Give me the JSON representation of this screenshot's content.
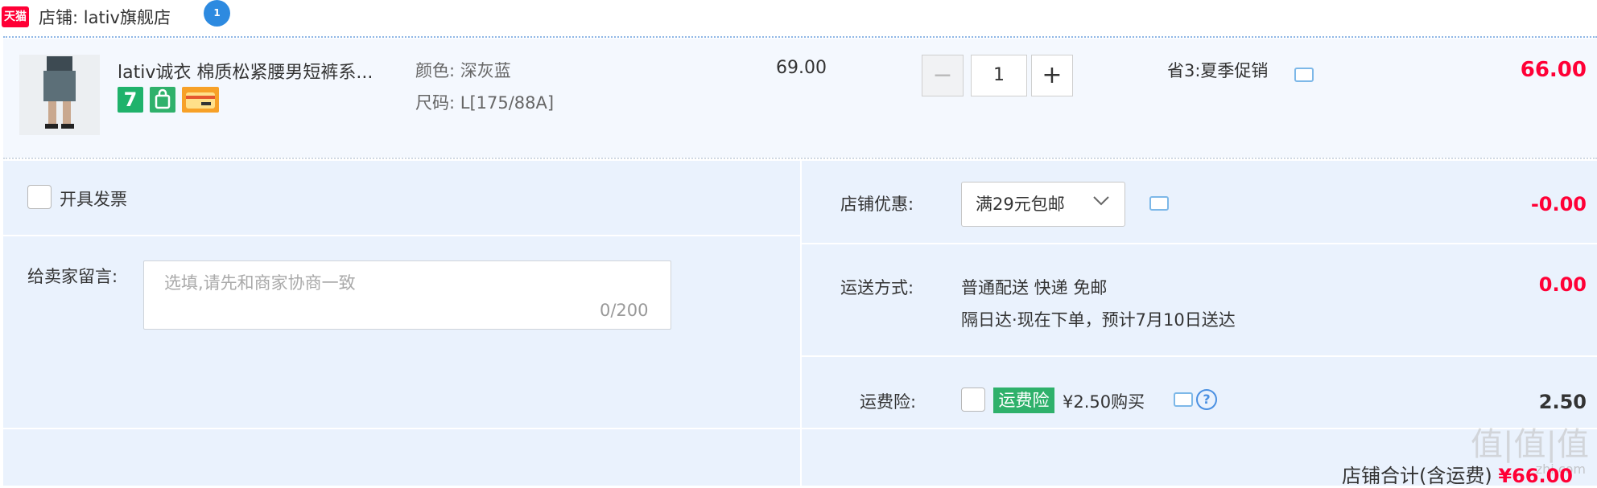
{
  "header": {
    "platform_badge": "天猫",
    "shop_label": "店铺: lativ旗舰店",
    "chat_badge": "1"
  },
  "item": {
    "title": "lativ诚衣 棉质松紧腰男短裤系...",
    "badge_7": "7",
    "color_label": "颜色: 深灰蓝",
    "size_label": "尺码: L[175/88A]",
    "unit_price": "69.00",
    "quantity": "1",
    "qty_minus": "−",
    "qty_plus": "+",
    "promotion": "省3:夏季促销",
    "subtotal": "66.00"
  },
  "invoice": {
    "label": "开具发票"
  },
  "message": {
    "label": "给卖家留言:",
    "placeholder": "选填,请先和商家协商一致",
    "counter": "0/200"
  },
  "shop_discount": {
    "label": "店铺优惠:",
    "selected": "满29元包邮",
    "amount": "-0.00"
  },
  "shipping": {
    "label": "运送方式:",
    "line1": "普通配送 快递 免邮",
    "line2": "隔日达·现在下单，预计7月10日送达",
    "amount": "0.00"
  },
  "insurance": {
    "label": "运费险:",
    "tag": "运费险",
    "price_text": "¥2.50购买",
    "help": "?",
    "amount": "2.50"
  },
  "shop_total": {
    "label": "店铺合计(含运费)",
    "amount": "¥66.00"
  },
  "watermark": {
    "main": "值|值|值",
    "sub": "zhi.com"
  },
  "colors": {
    "accent_red": "#ff0036",
    "panel_blue": "#eaf2fd",
    "row_blue": "#f4f8fe",
    "insurance_green": "#2fb16b",
    "link_blue": "#4a90e2"
  }
}
